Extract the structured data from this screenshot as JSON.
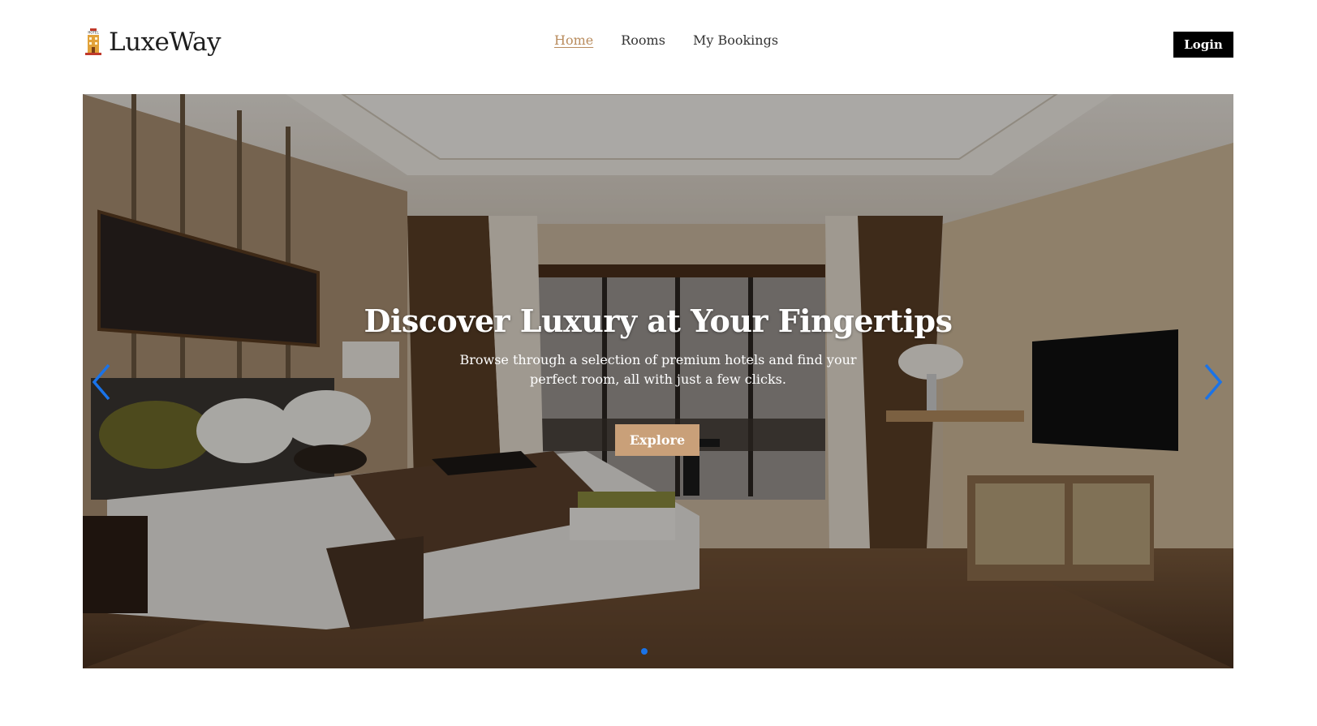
{
  "brand": {
    "name": "LuxeWay",
    "logo_icon": "hotel-tower-icon",
    "logo_badge": "HOTEL"
  },
  "nav": {
    "items": [
      {
        "label": "Home",
        "active": true
      },
      {
        "label": "Rooms",
        "active": false
      },
      {
        "label": "My Bookings",
        "active": false
      }
    ],
    "login_label": "Login"
  },
  "hero": {
    "title": "Discover Luxury at Your Fingertips",
    "subtitle": "Browse through a selection of premium hotels and find your perfect room, all with just a few clicks.",
    "cta_label": "Explore",
    "prev_icon": "chevron-left-icon",
    "next_icon": "chevron-right-icon",
    "slide_count": 1,
    "active_slide": 1
  },
  "colors": {
    "accent": "#c9a079",
    "nav_active": "#b98c5e",
    "arrow": "#1a73e8",
    "login_bg": "#000000"
  }
}
